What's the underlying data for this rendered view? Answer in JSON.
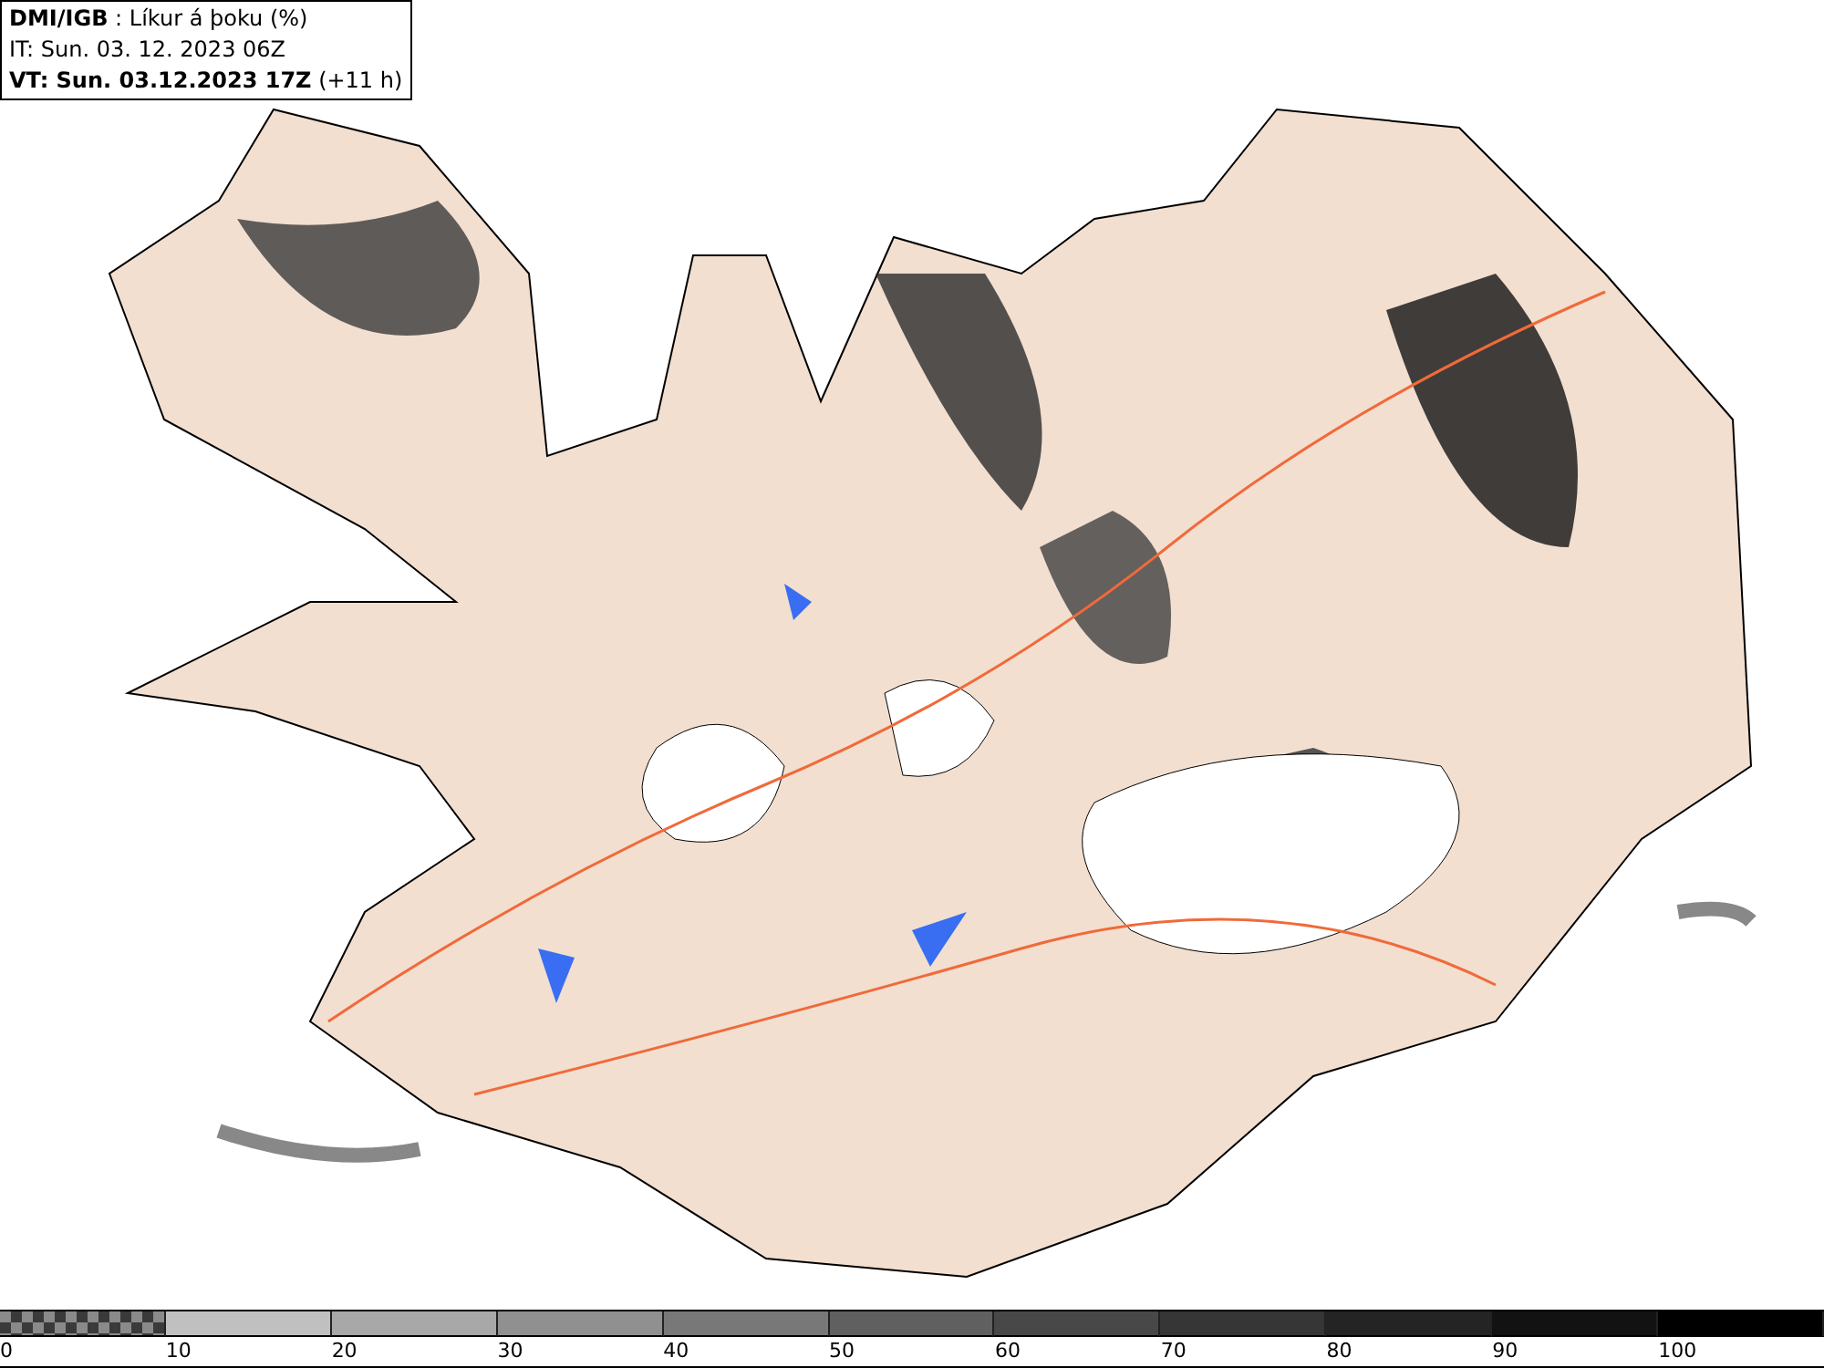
{
  "header": {
    "lines": [
      "**DMI/IGB** : Líkur á þoku (%)",
      "IT: Sun. 03. 12. 2023 06Z",
      "**VT: Sun. 03.12.2023 17Z** (+11 h)"
    ]
  },
  "legend": {
    "segments": [
      {
        "kind": "checker",
        "label": "0"
      },
      {
        "kind": "solid",
        "color": "#c0c0c0",
        "label": "10"
      },
      {
        "kind": "solid",
        "color": "#a8a8a8",
        "label": "20"
      },
      {
        "kind": "solid",
        "color": "#909090",
        "label": "30"
      },
      {
        "kind": "solid",
        "color": "#787878",
        "label": "40"
      },
      {
        "kind": "solid",
        "color": "#606060",
        "label": "50"
      },
      {
        "kind": "solid",
        "color": "#484848",
        "label": "60"
      },
      {
        "kind": "solid",
        "color": "#363636",
        "label": "70"
      },
      {
        "kind": "solid",
        "color": "#242424",
        "label": "80"
      },
      {
        "kind": "solid",
        "color": "#121212",
        "label": "90"
      },
      {
        "kind": "solid",
        "color": "#000000",
        "label": "100"
      }
    ]
  }
}
